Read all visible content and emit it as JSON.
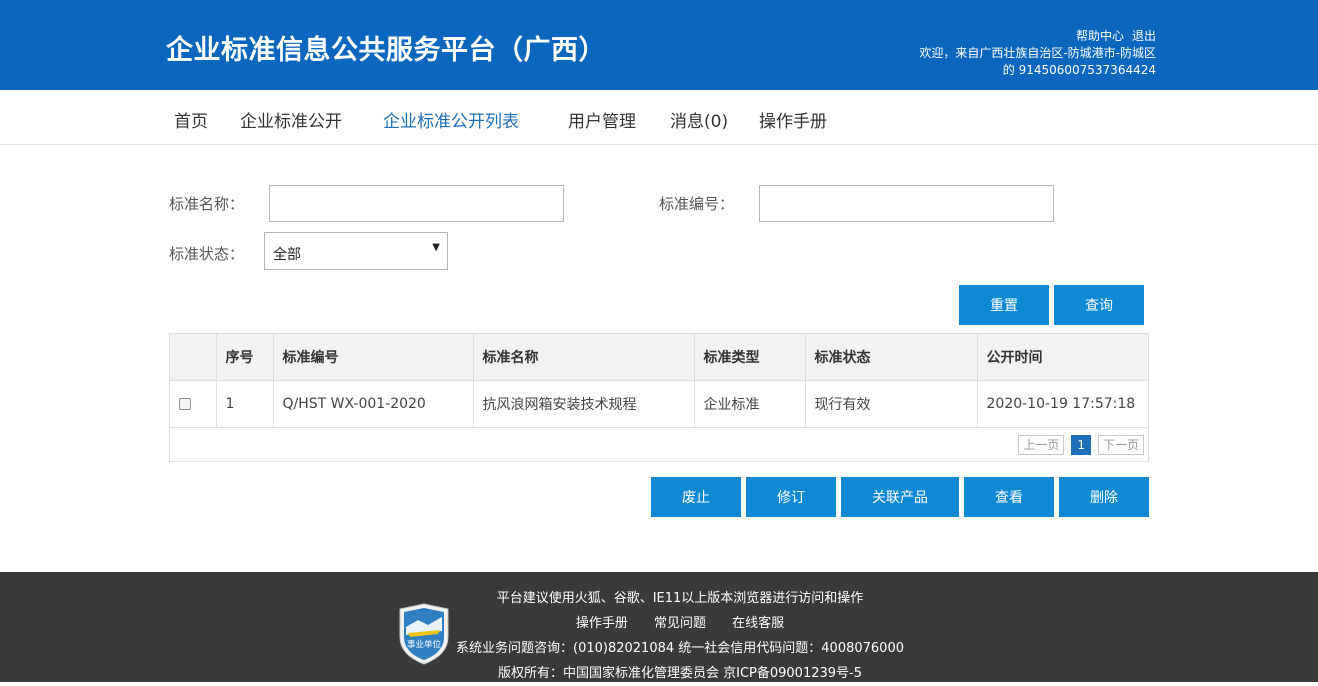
{
  "header": {
    "title": "企业标准信息公共服务平台（广西）",
    "links": [
      "帮助中心",
      "退出"
    ],
    "welcome": "欢迎，来自广西壮族自治区-防城港市-防城区",
    "account": "的 914506007537364424"
  },
  "nav": {
    "items": [
      "首页",
      "企业标准公开",
      "企业标准公开列表",
      "用户管理",
      "消息(0)",
      "操作手册"
    ],
    "active_index": 2
  },
  "form": {
    "name_label": "标准名称：",
    "number_label": "标准编号：",
    "status_label": "标准状态：",
    "name_value": "",
    "number_value": "",
    "status_value": "全部"
  },
  "buttons": {
    "reset": "重置",
    "query": "查询",
    "abolish": "废止",
    "revise": "修订",
    "related_products": "关联产品",
    "view": "查看",
    "delete": "删除"
  },
  "table": {
    "columns": [
      "",
      "序号",
      "标准编号",
      "标准名称",
      "标准类型",
      "标准状态",
      "公开时间"
    ],
    "rows": [
      [
        "",
        "1",
        "Q/HST WX-001-2020",
        "抗风浪网箱安装技术规程",
        "企业标准",
        "现行有效",
        "2020-10-19 17:57:18"
      ]
    ]
  },
  "pager": {
    "prev": "上一页",
    "current": "1",
    "next": "下一页"
  },
  "footer": {
    "line1": "平台建议使用火狐、谷歌、IE11以上版本浏览器进行访问和操作",
    "links": [
      "操作手册",
      "常见问题",
      "在线客服"
    ],
    "line3": "系统业务问题咨询：(010)82021084  统一社会信用代码问题：4008076000",
    "line4": "版权所有：中国国家标准化管理委员会   京ICP备09001239号-5",
    "badge_text": "事业单位",
    "badge_color": "#2f7fc1"
  },
  "colors": {
    "header_bg": "#0b67bd",
    "button_bg": "#0f89d4",
    "active_nav": "#1e6fb8",
    "footer_bg": "#3a3a3a"
  }
}
